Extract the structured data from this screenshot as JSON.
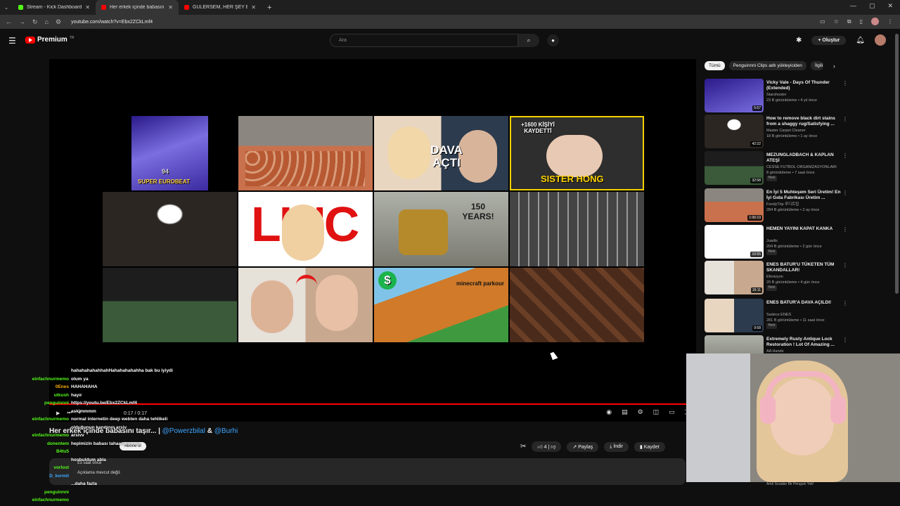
{
  "browser": {
    "tabs": [
      {
        "label": "Stream - Kick Dashboard",
        "color": "#53fc18"
      },
      {
        "label": "Her erkek içinde babasını taşır...",
        "color": "#ff0000"
      },
      {
        "label": "GÜLERSEM, HER ŞEY BİTER!! (1...",
        "color": "#ff0000"
      }
    ],
    "url": "youtube.com/watch?v=Ebx2ZCkLmf4"
  },
  "header": {
    "logo": "Premium",
    "logo_region": "TR",
    "search_placeholder": "Ara",
    "create_label": "Oluştur"
  },
  "player": {
    "time": "0:17 / 0:17",
    "thumb_captions": {
      "eurobeat": "SUPER EUROBEAT",
      "eurobeat_num": "94",
      "dava": "DAVA AÇTI",
      "sister_top": "+1600 KİŞİYİ KAYDETTİ",
      "sister_bottom": "SISTER HONG",
      "linc": "LINC",
      "years": "150 YEARS!",
      "minecraft": "minecraft parkour",
      "dollar": "$"
    }
  },
  "video": {
    "title": "Her erkek içinde babasını taşır... |",
    "mention1": "@Powerzbilal",
    "amp": "&",
    "mention2": "@Burhi",
    "subscribe_label": "Abone ol",
    "likes": "4",
    "share_label": "Paylaş",
    "download_label": "İndir",
    "save_label": "Kaydet",
    "views_time": "23 saat önce",
    "description": "Açıklama mevcut değil."
  },
  "chat": [
    {
      "user": "",
      "text": "hahahahahahhahHahahahahahha bak bu iyiydi",
      "color": "#ffffff"
    },
    {
      "user": "einfachnurmemo",
      "text": "olum ya",
      "color": "#53fc18"
    },
    {
      "user": "0Enes",
      "text": "HAHAHAHA",
      "color": "#ffb000"
    },
    {
      "user": "utkush",
      "text": "hayır",
      "color": "#53fc18"
    },
    {
      "user": "penguinnni",
      "text": "https://youtu.be/Ebx2ZCkLmf4",
      "color": "#53fc18"
    },
    {
      "user": "",
      "text": "askimmmm",
      "color": "#ffffff"
    },
    {
      "user": "einfachnurmemo",
      "text": "normal internetin deep webten daha tehlikeli",
      "color": "#53fc18"
    },
    {
      "user": "",
      "text": "olduğunun kanıtının arsiv",
      "color": "#ffffff"
    },
    {
      "user": "einfachnurmemo",
      "text": "arsivv",
      "color": "#53fc18"
    },
    {
      "user": "donentem",
      "text": "hepimizin babası tahaammm mı",
      "color": "#53fc18"
    },
    {
      "user": "B4tu5",
      "text": "",
      "color": "#53fc18"
    },
    {
      "user": "",
      "text": "hoşbuldum abla",
      "color": "#ffffff"
    },
    {
      "user": "vorlost",
      "text": "",
      "color": "#53fc18"
    },
    {
      "user": "D_kermit",
      "text": "",
      "color": "#3ea6ff"
    },
    {
      "user": "",
      "text": "...daha fazla",
      "color": "#ffffff"
    },
    {
      "user": "penguinnni",
      "text": "",
      "color": "#53fc18"
    },
    {
      "user": "einfachnurmemo",
      "text": "",
      "color": "#53fc18"
    }
  ],
  "sidebar": {
    "chips": [
      "Tümü",
      "Penguinnni Clips adlı yükleyiciden",
      "İlgili"
    ],
    "items": [
      {
        "title": "Vicky Vale - Days Of Thunder (Extended)",
        "channel": "Starshooter",
        "meta": "23 B görüntüleme • 4 yıl önce",
        "duration": "5:57",
        "new": ""
      },
      {
        "title": "How to remove black dirt stains from a shaggy rug/Satisfying ...",
        "channel": "Master Carpet Cleaner",
        "meta": "18 B görüntüleme • 1 ay önce",
        "duration": "42:22",
        "new": ""
      },
      {
        "title": "MEZUNGLADBACH & KAPLAN ATEŞİ",
        "channel": "CESSE FUTBOL ORGANİZASYONLARI",
        "meta": "8 görüntüleme • 7 saat önce",
        "duration": "32:58",
        "new": "Yeni"
      },
      {
        "title": "En İyi 5 Muhteşem Seri Üretim! En İyi Gıda Fabrikası Üretim ...",
        "channel": "FoodyTrip 푸디트립",
        "meta": "284 B görüntüleme • 2 ay önce",
        "duration": "1:06:10",
        "new": ""
      },
      {
        "title": "HEMEN YAYINI KAPAT KANKA",
        "channel": "Juadis",
        "meta": "204 B görüntüleme • 2 gün önce",
        "duration": "10:55",
        "new": "Yeni"
      },
      {
        "title": "ENES BATUR'U TÜKETEN TÜM SKANDALLAR!",
        "channel": "Efevizyon",
        "meta": "20 B görüntüleme • 4 gün önce",
        "duration": "16:11",
        "new": "Yeni"
      },
      {
        "title": "ENES BATUR'A DAVA AÇILDI!",
        "channel": "Sadece ENES",
        "meta": "281 B görüntüleme • 11 saat önce",
        "duration": "9:58",
        "new": "Yeni"
      },
      {
        "title": "Extremely Rusty Antique Lock Restoration ! Lot Of Amazing ...",
        "channel": "AA Hands",
        "meta": "",
        "duration": "",
        "new": ""
      }
    ],
    "bottom_text": "Artık Sıradan Bir Penguin Yok!"
  },
  "colors": {
    "accent": "#ff0000",
    "link": "#3ea6ff",
    "bg": "#0f0f0f"
  }
}
